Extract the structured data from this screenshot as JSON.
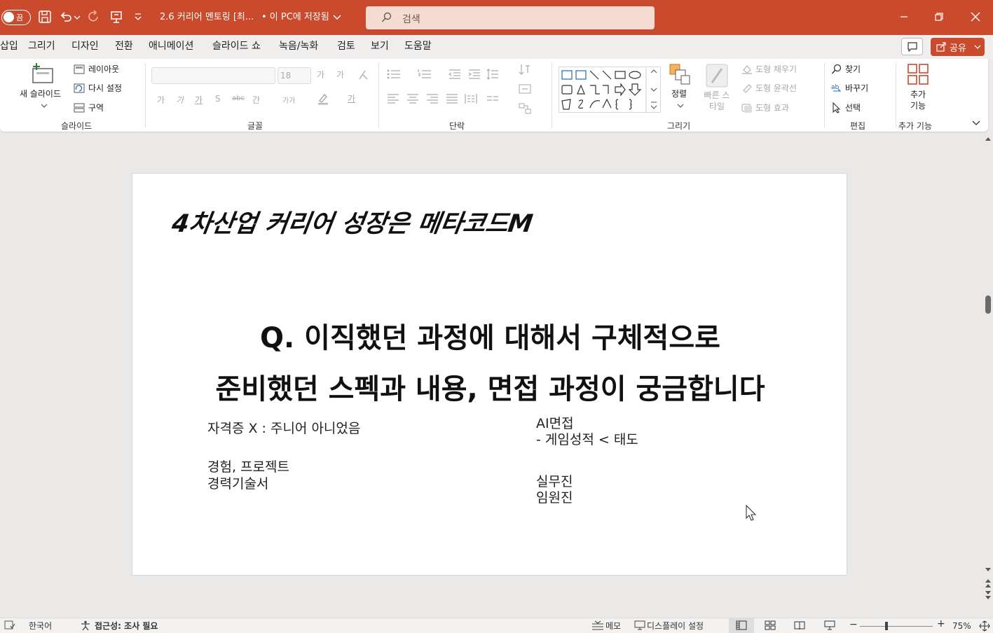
{
  "titlebar": {
    "autosave_label": "끔",
    "doc_title": "2.6 커리어 멘토링 [최...",
    "save_status": "• 이 PC에 저장됨",
    "search_placeholder": "검색"
  },
  "tabs": [
    "삽입",
    "그리기",
    "디자인",
    "전환",
    "애니메이션",
    "슬라이드 쇼",
    "녹음/녹화",
    "검토",
    "보기",
    "도움말"
  ],
  "share_label": "공유",
  "ribbon": {
    "slides": {
      "new_slide": "새 슬라이드",
      "layout": "레이아웃",
      "reset": "다시 설정",
      "section": "구역",
      "group_label": "슬라이드"
    },
    "font": {
      "font_size": "18",
      "grow": "가",
      "shrink": "가",
      "bold": "가",
      "italic": "가",
      "underline": "가",
      "strike": "S",
      "strikethrough2": "abc",
      "spacing": "간",
      "case": "가가",
      "color": "가",
      "group_label": "글꼴"
    },
    "paragraph": {
      "group_label": "단락"
    },
    "drawing": {
      "arrange": "정렬",
      "quick_styles": "빠른 스타일",
      "fill": "도형 채우기",
      "outline": "도형 윤곽선",
      "effects": "도형 효과",
      "group_label": "그리기"
    },
    "editing": {
      "find": "찾기",
      "replace": "바꾸기",
      "select": "선택",
      "group_label": "편집"
    },
    "addins": {
      "label": "추가 기능",
      "group_label": "추가 기능"
    }
  },
  "slide": {
    "title": "4차산업 커리어 성장은 메타코드M",
    "question_line1": "Q. 이직했던 과정에 대해서 구체적으로",
    "question_line2": "준비했던 스펙과 내용, 면접 과정이 궁금합니다",
    "left": {
      "line1": "자격증 X : 주니어 아니었음",
      "line2": "경험, 프로젝트",
      "line3": "경력기술서"
    },
    "right": {
      "line1": "AI면접",
      "line2": "- 게임성적 < 태도",
      "line3": "실무진",
      "line4": "임원진"
    }
  },
  "statusbar": {
    "language": "한국어",
    "accessibility": "접근성: 조사 필요",
    "notes": "메모",
    "display_settings": "디스플레이 설정",
    "zoom": "75%"
  },
  "colors": {
    "accent": "#c94a2c",
    "ribbon_bg": "#ffffff",
    "canvas_bg": "#ebe9e8"
  }
}
